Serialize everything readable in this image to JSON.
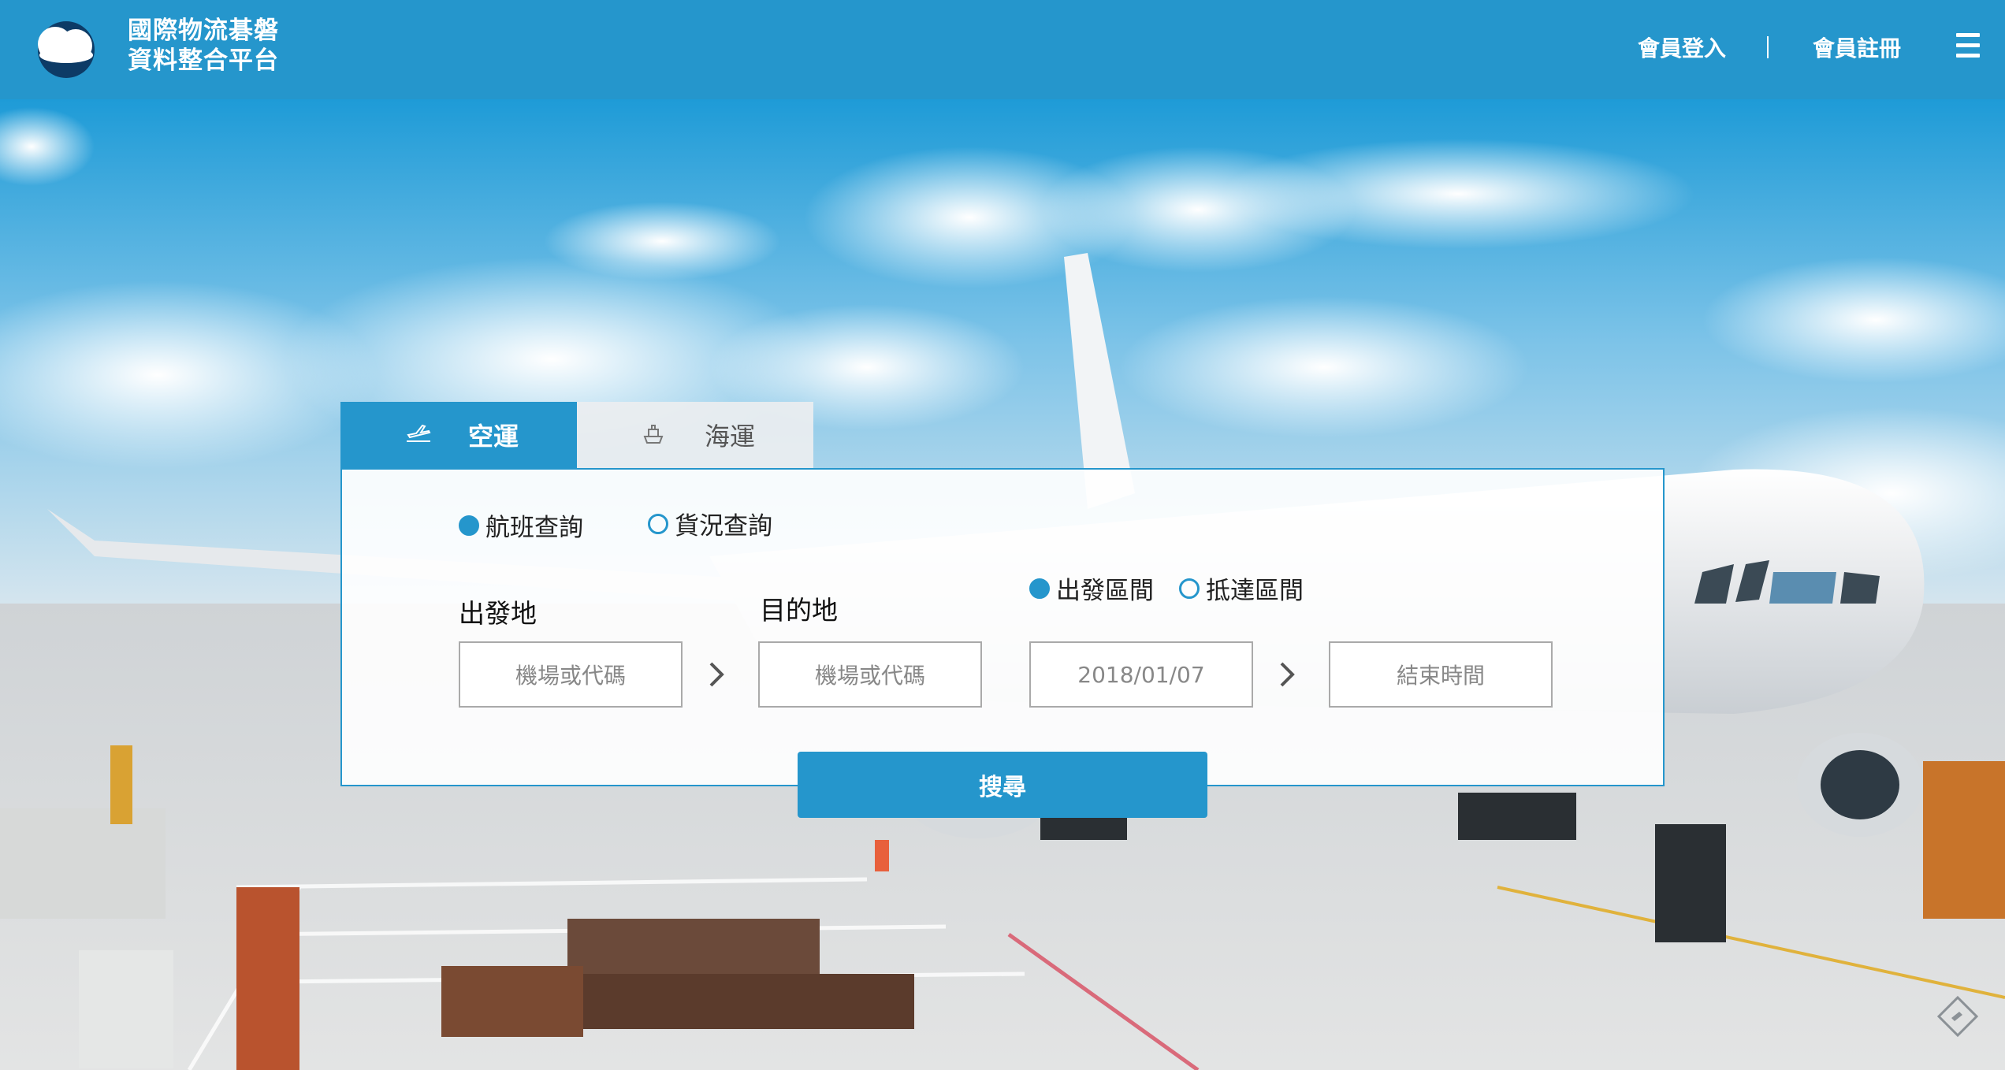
{
  "header": {
    "brand_line1": "國際物流碁磐",
    "brand_line2": "資料整合平台",
    "login": "會員登入",
    "register": "會員註冊",
    "menu_icon": "hamburger-icon"
  },
  "tabs": [
    {
      "label": "空運",
      "icon": "airplane-icon",
      "active": true
    },
    {
      "label": "海運",
      "icon": "ship-icon",
      "active": false
    }
  ],
  "query_type": {
    "flight": "航班查詢",
    "cargo": "貨況查詢",
    "selected": "航班查詢"
  },
  "date_mode": {
    "departure": "出發區間",
    "arrival": "抵達區間",
    "selected": "出發區間"
  },
  "fields": {
    "origin_label": "出發地",
    "destination_label": "目的地",
    "origin_placeholder": "機場或代碼",
    "destination_placeholder": "機場或代碼",
    "start_date": "2018/01/07",
    "end_placeholder": "結束時間"
  },
  "search_button": "搜尋",
  "colors": {
    "brand": "#2596cc",
    "panel_border": "#2596cc"
  }
}
